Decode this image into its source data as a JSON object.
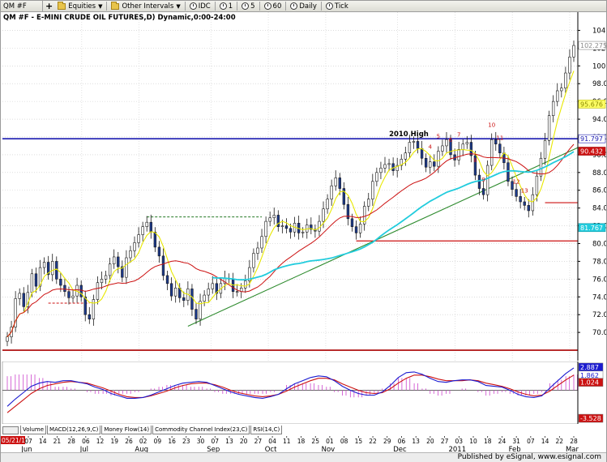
{
  "toolbar": {
    "symbol": "QM #F",
    "equities": "Equities",
    "other_intervals": "Other Intervals",
    "intervals": [
      "IDC",
      "1",
      "5",
      "60",
      "Daily",
      "Tick"
    ]
  },
  "footer": {
    "publisher": "Published by eSignal, www.esignal.com"
  },
  "chart_data": [
    {
      "type": "bar",
      "title": "QM #F - E-MINI CRUDE OIL FUTURES,D) Dynamic,0:00-24:00",
      "title_short": "QM #F - E-MINI CRUDE OIL FUTURES,D) Dynamic,0:00-24:00",
      "xlabel": "",
      "ylabel": "",
      "ylim": [
        67,
        105.5
      ],
      "price_ticks": [
        70,
        72,
        74,
        76,
        78,
        80,
        82,
        84,
        86,
        88,
        90,
        92,
        94,
        96,
        98,
        100,
        102,
        104
      ],
      "date_ticks": [
        "07",
        "14",
        "21",
        "28",
        "06",
        "12",
        "19",
        "26",
        "02",
        "09",
        "16",
        "23",
        "30",
        "07",
        "13",
        "20",
        "27",
        "04",
        "11",
        "18",
        "25",
        "01",
        "08",
        "15",
        "22",
        "29",
        "06",
        "13",
        "20",
        "27",
        "03",
        "10",
        "18",
        "24",
        "31",
        "07",
        "14",
        "22",
        "28"
      ],
      "month_labels": [
        "Jun",
        "Jul",
        "Aug",
        "Sep",
        "Oct",
        "Nov",
        "Dec",
        "2011",
        "Feb",
        "Mar"
      ],
      "start_label": "05/21/10",
      "grid": true,
      "annotations": {
        "high_label": "2010 High",
        "high_level": 91.8,
        "support_level_1": 80.3,
        "support_level_2": 84.6,
        "bottom_line": 68.0,
        "dashed_level_1": 73.3,
        "dashed_level_2": 83.0,
        "seq_labels_red": [
          "4",
          "5",
          "6",
          "7",
          "8",
          "9",
          "10",
          "11",
          "12",
          "13",
          "1"
        ]
      },
      "last_price_label": "102.275",
      "series": [
        {
          "name": "",
          "values": [
            69.5,
            70.6,
            73.8,
            74.4,
            72.9,
            74.5,
            76.6,
            75.2,
            77.3,
            77.9,
            76.5,
            78.0,
            76.0,
            75.3,
            74.6,
            73.9,
            74.1,
            75.3,
            74.0,
            72.0,
            71.5,
            73.7,
            75.6,
            76.0,
            76.4,
            77.7,
            78.5,
            77.4,
            76.2,
            78.4,
            79.2,
            80.1,
            81.0,
            81.9,
            82.4,
            81.3,
            79.6,
            78.6,
            76.4,
            75.5,
            74.1,
            75.0,
            73.9,
            73.6,
            74.9,
            72.6,
            71.5,
            73.5,
            74.2,
            74.9,
            75.5,
            74.4,
            75.5,
            76.1,
            76.0,
            74.6,
            74.6,
            75.0,
            75.8,
            77.3,
            78.9,
            79.5,
            80.8,
            82.5,
            82.9,
            83.2,
            81.9,
            82.0,
            81.7,
            81.3,
            82.3,
            81.2,
            81.3,
            82.1,
            81.6,
            81.4,
            82.5,
            83.9,
            85.0,
            86.5,
            87.4,
            86.2,
            84.4,
            82.8,
            81.9,
            81.2,
            82.2,
            84.2,
            85.0,
            87.0,
            88.0,
            88.5,
            88.9,
            89.0,
            88.2,
            88.8,
            89.5,
            90.2,
            91.4,
            91.5,
            90.7,
            89.6,
            88.6,
            89.2,
            88.7,
            90.4,
            91.0,
            91.7,
            90.0,
            89.4,
            90.6,
            91.2,
            91.4,
            89.9,
            87.7,
            86.2,
            85.5,
            88.8,
            91.7,
            91.2,
            90.2,
            89.1,
            87.0,
            86.1,
            85.3,
            84.7,
            84.3,
            83.7,
            85.5,
            87.6,
            89.6,
            91.6,
            94.4,
            96.0,
            97.2,
            97.5,
            99.2,
            101.0,
            102.3
          ]
        },
        {
          "name": "90.432",
          "values": [
            null
          ]
        },
        {
          "name": "95.676",
          "values": [
            null
          ]
        },
        {
          "name": "81.767",
          "values": [
            null
          ]
        },
        {
          "name": "91.797",
          "values": [
            null
          ]
        }
      ]
    },
    {
      "type": "line",
      "title": "",
      "ylim": [
        -4.0,
        3.4
      ],
      "zero_level": 0,
      "right_labels": [
        "2.887",
        "1.862",
        "1.024",
        "-3.528"
      ],
      "study_tabs": [
        "Volume",
        "MACD(12,26,9,C)",
        "Money Flow(14)",
        "Commodity Channel Index(23,C)",
        "RSI(14,C)"
      ],
      "series": [
        {
          "name": "",
          "values": [
            -2.0,
            -1.1,
            -0.3,
            0.5,
            0.9,
            1.1,
            1.0,
            1.2,
            1.2,
            1.0,
            0.8,
            0.4,
            0.1,
            -0.4,
            -0.7,
            -1.0,
            -1.0,
            -0.9,
            -0.6,
            -0.2,
            0.2,
            0.6,
            0.9,
            1.0,
            1.1,
            1.0,
            0.6,
            0.2,
            -0.2,
            -0.5,
            -0.7,
            -0.9,
            -1.0,
            -0.8,
            -0.5,
            0.2,
            0.8,
            1.2,
            1.6,
            1.8,
            1.7,
            1.2,
            0.5,
            0.0,
            -0.4,
            -0.6,
            -0.6,
            -0.2,
            0.6,
            1.6,
            2.2,
            2.3,
            2.0,
            1.5,
            1.1,
            1.0,
            1.2,
            1.3,
            1.3,
            1.1,
            0.6,
            0.5,
            0.4,
            0.0,
            -0.5,
            -0.8,
            -0.9,
            -0.7,
            0.3,
            1.2,
            2.1,
            2.8
          ]
        },
        {
          "name": "",
          "values": [
            -2.8,
            -2.0,
            -1.2,
            -0.4,
            0.2,
            0.6,
            0.8,
            1.0,
            1.1,
            1.0,
            0.9,
            0.6,
            0.3,
            -0.1,
            -0.5,
            -0.8,
            -0.9,
            -0.9,
            -0.7,
            -0.4,
            -0.1,
            0.3,
            0.6,
            0.8,
            0.9,
            0.9,
            0.7,
            0.4,
            0.0,
            -0.3,
            -0.5,
            -0.7,
            -0.8,
            -0.7,
            -0.5,
            -0.1,
            0.4,
            0.8,
            1.2,
            1.5,
            1.5,
            1.3,
            0.8,
            0.4,
            0.0,
            -0.3,
            -0.4,
            -0.3,
            0.2,
            0.9,
            1.5,
            1.9,
            1.9,
            1.7,
            1.4,
            1.2,
            1.2,
            1.2,
            1.3,
            1.2,
            0.9,
            0.7,
            0.5,
            0.2,
            -0.2,
            -0.5,
            -0.7,
            -0.6,
            -0.1,
            0.6,
            1.3,
            1.9
          ]
        }
      ]
    }
  ]
}
